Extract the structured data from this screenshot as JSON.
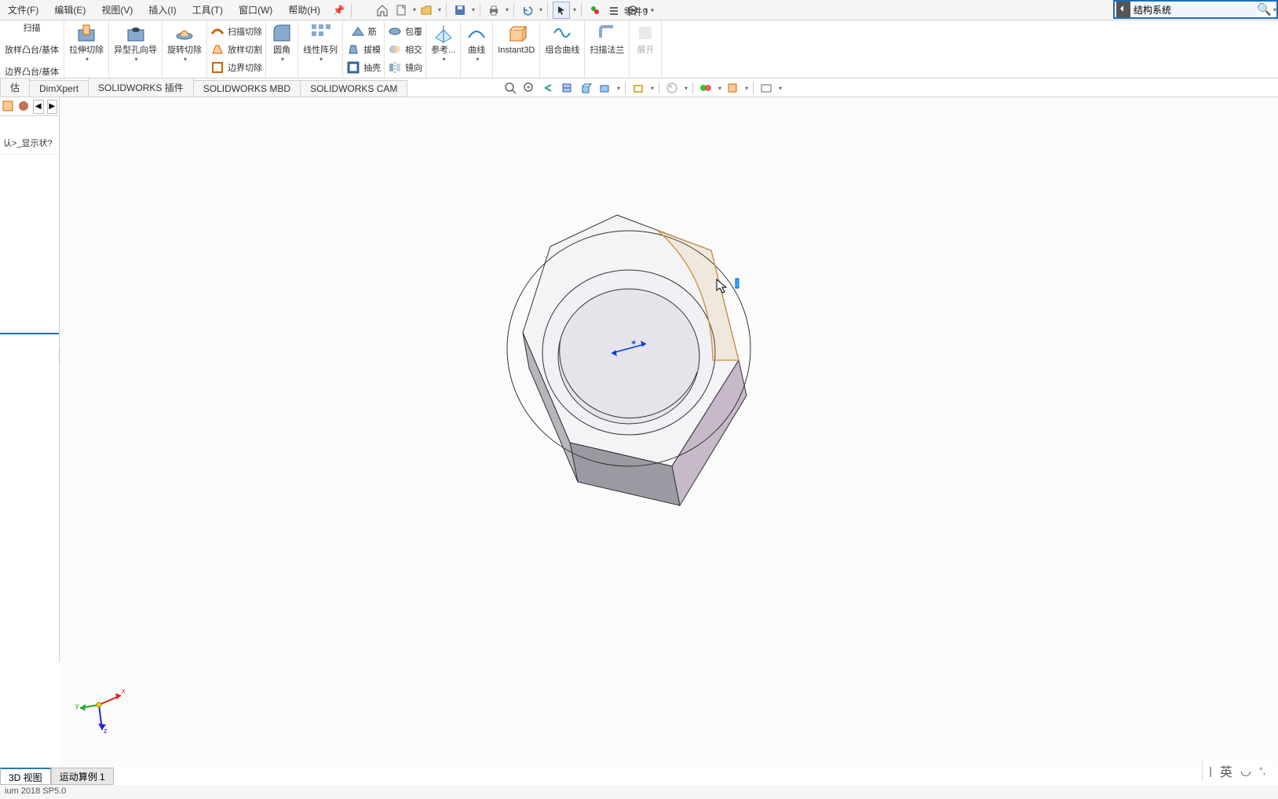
{
  "menu": {
    "file": "文件(F)",
    "edit": "编辑(E)",
    "view": "视图(V)",
    "insert": "插入(I)",
    "tools": "工具(T)",
    "window": "窗口(W)",
    "help": "帮助(H)"
  },
  "doc_title": "零件9 *",
  "search": {
    "placeholder": "结构系统"
  },
  "ribbon": {
    "col0": {
      "l1": "扫描",
      "l2": "放样凸台/基体",
      "l3": "边界凸台/基体"
    },
    "extrude_cut": "拉伸切除",
    "hole_wizard": "异型孔向导",
    "revolve_cut": "旋转切除",
    "swept_cut": "扫描切除",
    "loft_cut": "放样切割",
    "boundary_cut": "边界切除",
    "fillet": "圆角",
    "linear_pattern": "线性阵列",
    "rib": "筋",
    "draft": "拔模",
    "shell": "抽壳",
    "wrap": "包覆",
    "intersect": "相交",
    "mirror": "镜向",
    "ref_geom": "参考...",
    "curves": "曲线",
    "instant3d": "Instant3D",
    "composite_curve": "组合曲线",
    "swept_flange": "扫描法兰",
    "expand": "展开"
  },
  "tabs": {
    "t1": "估",
    "t2": "DimXpert",
    "t3": "SOLIDWORKS 插件",
    "t4": "SOLIDWORKS MBD",
    "t5": "SOLIDWORKS CAM"
  },
  "leftpanel": {
    "config": "认>_显示状?"
  },
  "bottom_tabs": {
    "view3d": "3D 视图",
    "motion": "运动算例 1"
  },
  "status": "ium 2018 SP5.0",
  "ime": {
    "lang": "英"
  },
  "triad": {
    "x": "x",
    "y": "y",
    "z": "z"
  }
}
